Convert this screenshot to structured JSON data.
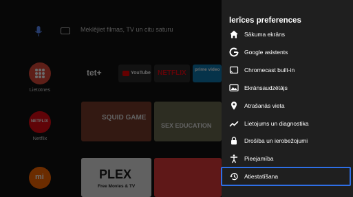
{
  "home": {
    "search_hint": "Meklējiet filmas, TV un citu saturu",
    "rail": [
      {
        "label": "Lietotnes",
        "icon": "apps-grid-icon"
      },
      {
        "label": "Netflix",
        "icon": "netflix-icon"
      },
      {
        "label": "",
        "icon": "mi-icon"
      }
    ],
    "apps_row": [
      "tet+",
      "YouTube",
      "NETFLIX",
      "prime video"
    ],
    "content_row": [
      "SQUID GAME",
      "SEX EDUCATION"
    ],
    "bottom_row": [
      "PLEX",
      "Free Movies & TV"
    ]
  },
  "panel": {
    "title": "Ierīces preferences",
    "items": [
      {
        "label": "Sākuma ekrāns",
        "icon": "home-icon"
      },
      {
        "label": "Google asistents",
        "icon": "google-icon"
      },
      {
        "label": "Chromecast built-in",
        "icon": "cast-icon"
      },
      {
        "label": "Ekrānsaudzētājs",
        "icon": "screensaver-icon"
      },
      {
        "label": "Atrašanās vieta",
        "icon": "location-pin-icon"
      },
      {
        "label": "Lietojums un diagnostika",
        "icon": "trending-icon"
      },
      {
        "label": "Drošība un ierobežojumi",
        "icon": "lock-icon"
      },
      {
        "label": "Pieejamība",
        "icon": "accessibility-icon"
      },
      {
        "label": "Atiestatīšana",
        "icon": "history-reset-icon"
      }
    ],
    "focused_index": 8
  },
  "colors": {
    "accent": "#2e6fe6",
    "panel_bg": "#1f1f1f"
  }
}
